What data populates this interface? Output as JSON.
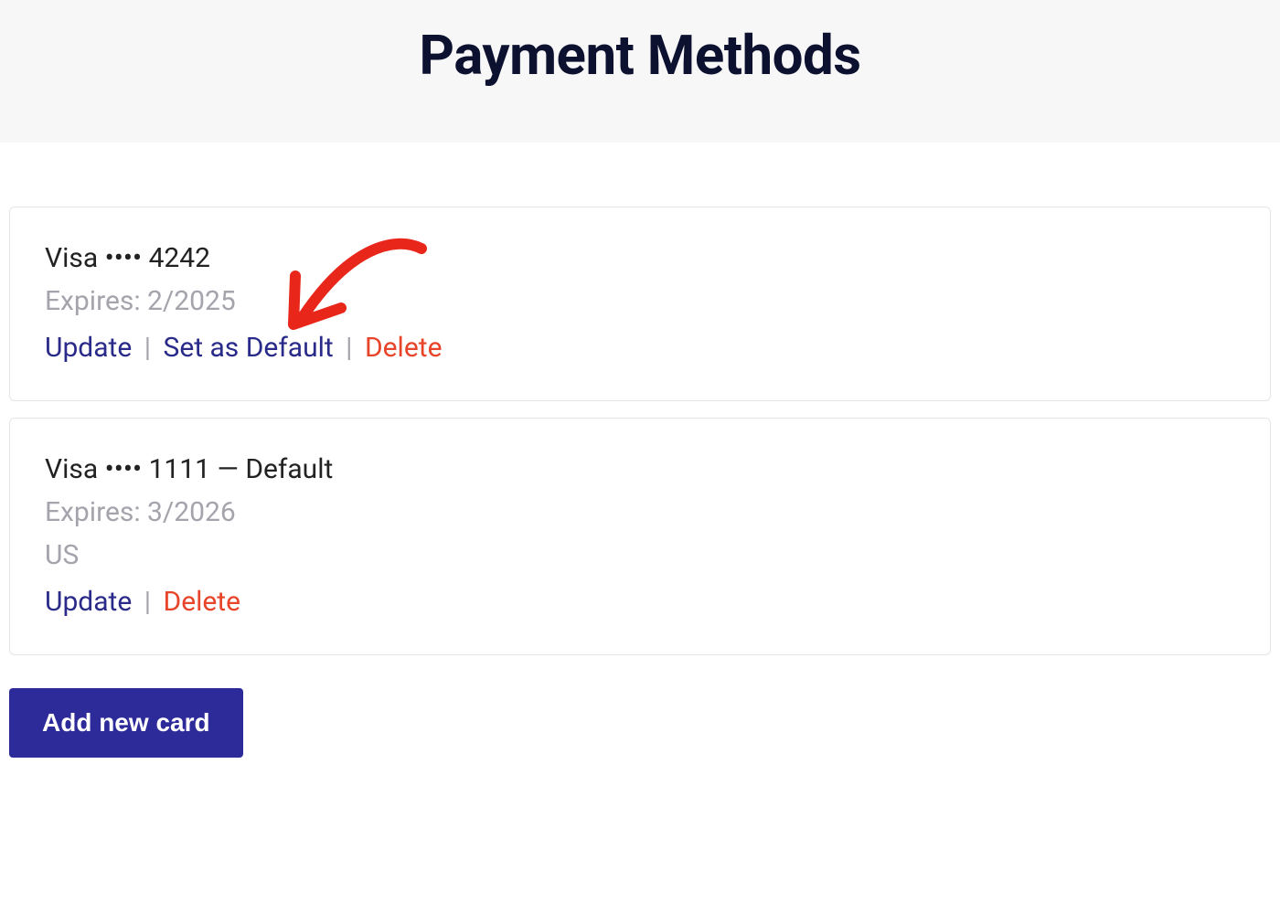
{
  "header": {
    "title": "Payment Methods"
  },
  "cards": [
    {
      "title": "Visa •••• 4242",
      "expiry": "Expires: 2/2025",
      "actions": {
        "update": "Update",
        "setDefault": "Set as Default",
        "delete": "Delete"
      }
    },
    {
      "title": "Visa •••• 1111 — Default",
      "expiry": "Expires: 3/2026",
      "country": "US",
      "actions": {
        "update": "Update",
        "delete": "Delete"
      }
    }
  ],
  "addButton": {
    "label": "Add new card"
  },
  "separator": "|"
}
